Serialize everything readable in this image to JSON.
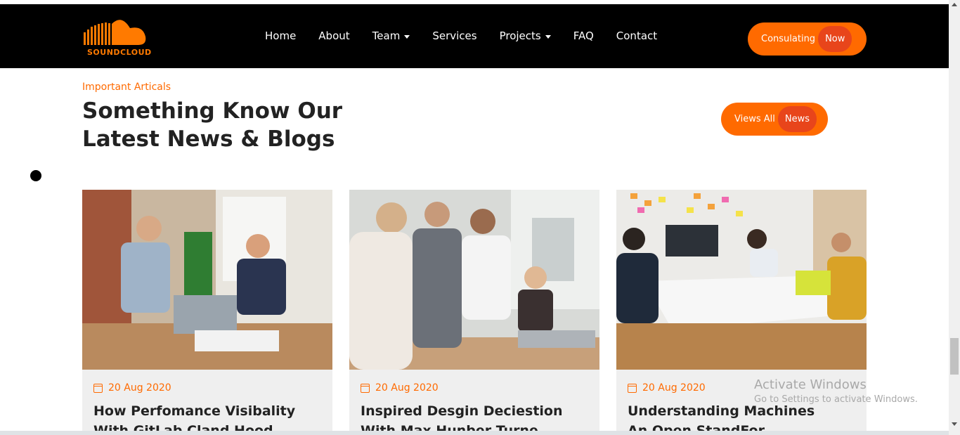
{
  "brand": {
    "logo_text": "SOUNDCLOUD",
    "accent_color": "#ff6a00",
    "accent_dark": "#e8451b"
  },
  "nav": {
    "items": [
      {
        "label": "Home",
        "dropdown": false
      },
      {
        "label": "About",
        "dropdown": false
      },
      {
        "label": "Team",
        "dropdown": true
      },
      {
        "label": "Services",
        "dropdown": false
      },
      {
        "label": "Projects",
        "dropdown": true
      },
      {
        "label": "FAQ",
        "dropdown": false
      },
      {
        "label": "Contact",
        "dropdown": false
      }
    ]
  },
  "header_cta": {
    "label": "Consulating",
    "accent": "Now"
  },
  "section": {
    "eyebrow": "Important Articals",
    "title_line1": "Something Know Our",
    "title_line2": "Latest News & Blogs",
    "cta_label": "Views All",
    "cta_accent": "News"
  },
  "cards": [
    {
      "date": "20 Aug 2020",
      "title_line1": "How Perfomance Visibality",
      "title_line2": "With GitLab Cland Hood"
    },
    {
      "date": "20 Aug 2020",
      "title_line1": "Inspired Desgin Deciestion",
      "title_line2": "With Max Hunber Turne"
    },
    {
      "date": "20 Aug 2020",
      "title_line1": "Understanding Machines",
      "title_line2": "An Open StandFor"
    }
  ],
  "watermark": {
    "line1": "Activate Windows",
    "line2": "Go to Settings to activate Windows."
  }
}
